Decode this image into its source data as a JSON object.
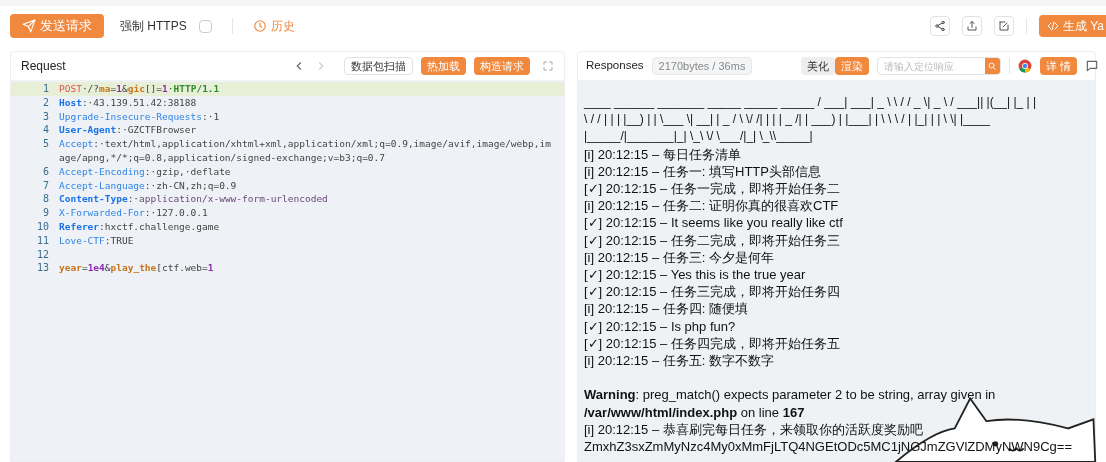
{
  "toolbar": {
    "send_button": "发送请求",
    "force_https": {
      "label": "强制 HTTPS",
      "checked": false
    },
    "history": "历史",
    "generate_button": "生成 Ya"
  },
  "request": {
    "title": "Request",
    "back_disabled": false,
    "forward_disabled": true,
    "scan_button": "数据包扫描",
    "hot_reload_button": "热加载",
    "build_button": "构造请求",
    "lines": [
      {
        "number": "1",
        "highlighted": true,
        "segments": [
          {
            "kind": "method",
            "text": "POST"
          },
          {
            "kind": "plain",
            "text": "·/?"
          },
          {
            "kind": "param",
            "text": "ma"
          },
          {
            "kind": "plain",
            "text": "="
          },
          {
            "kind": "number",
            "text": "1"
          },
          {
            "kind": "plain",
            "text": "&"
          },
          {
            "kind": "param",
            "text": "gic"
          },
          {
            "kind": "plain",
            "text": "[]="
          },
          {
            "kind": "number",
            "text": "1"
          },
          {
            "kind": "plain",
            "text": "·"
          },
          {
            "kind": "protocol",
            "text": "HTTP/1.1"
          }
        ]
      },
      {
        "number": "2",
        "highlighted": false,
        "segments": [
          {
            "kind": "key",
            "text": "Host"
          },
          {
            "kind": "plain",
            "text": ":·43.139.51.42:38188"
          }
        ]
      },
      {
        "number": "3",
        "highlighted": false,
        "segments": [
          {
            "kind": "key-light",
            "text": "Upgrade-Insecure-Requests"
          },
          {
            "kind": "plain",
            "text": ":·1"
          }
        ]
      },
      {
        "number": "4",
        "highlighted": false,
        "segments": [
          {
            "kind": "key",
            "text": "User-Agent"
          },
          {
            "kind": "plain",
            "text": ":·GZCTFBrowser"
          }
        ]
      },
      {
        "number": "5",
        "highlighted": false,
        "segments": [
          {
            "kind": "key-light",
            "text": "Accept"
          },
          {
            "kind": "plain",
            "text": ":·text/html,application/xhtml+xml,application/xml;q=0.9,image/avif,image/webp,image/apng,*/*;q=0.8,application/signed-exchange;v=b3;q=0.7"
          }
        ]
      },
      {
        "number": "6",
        "highlighted": false,
        "segments": [
          {
            "kind": "key-light",
            "text": "Accept-Encoding"
          },
          {
            "kind": "plain",
            "text": ":·gzip,·deflate"
          }
        ]
      },
      {
        "number": "7",
        "highlighted": false,
        "segments": [
          {
            "kind": "key-light",
            "text": "Accept-Language"
          },
          {
            "kind": "plain",
            "text": ":·zh-CN,zh;q=0.9"
          }
        ]
      },
      {
        "number": "8",
        "highlighted": false,
        "segments": [
          {
            "kind": "key",
            "text": "Content-Type"
          },
          {
            "kind": "plain",
            "text": ":·"
          },
          {
            "kind": "string",
            "text": "application/x-www-form-urlencoded"
          }
        ]
      },
      {
        "number": "9",
        "highlighted": false,
        "segments": [
          {
            "kind": "key-light",
            "text": "X-Forwarded-For"
          },
          {
            "kind": "plain",
            "text": ":·127.0.0.1"
          }
        ]
      },
      {
        "number": "10",
        "highlighted": false,
        "segments": [
          {
            "kind": "key",
            "text": "Referer"
          },
          {
            "kind": "plain",
            "text": ":hxctf.challenge.game"
          }
        ]
      },
      {
        "number": "11",
        "highlighted": false,
        "segments": [
          {
            "kind": "key-light",
            "text": "Love-CTF"
          },
          {
            "kind": "plain",
            "text": ":TRUE"
          }
        ]
      },
      {
        "number": "12",
        "highlighted": false
      },
      {
        "number": "13",
        "highlighted": false,
        "segments": [
          {
            "kind": "param",
            "text": "year"
          },
          {
            "kind": "plain",
            "text": "="
          },
          {
            "kind": "number",
            "text": "1e4"
          },
          {
            "kind": "plain",
            "text": "&"
          },
          {
            "kind": "param",
            "text": "play_the"
          },
          {
            "kind": "plain",
            "text": "[ctf.web="
          },
          {
            "kind": "number",
            "text": "1"
          }
        ]
      }
    ]
  },
  "response": {
    "title": "Responses",
    "stats": "2170bytes / 36ms",
    "view_modes": [
      {
        "label": "美化",
        "selected": false
      },
      {
        "label": "渲染",
        "selected": true
      }
    ],
    "search": {
      "placeholder": "请输入定位响应"
    },
    "details_button": "详 情",
    "body": [
      {
        "kind": "art",
        "text": "____ ______ _______ _____ _____ _____ / ___| ___| _ \\ \\ / / _ \\| _ \\ / ___|| |(__| |_ | |"
      },
      {
        "kind": "art",
        "text": "\\ / / | | | |__) | | \\___ \\| __| | _ / \\ \\/ /| | | | _ /| | ___) | |___| | \\ \\ \\ / | |_| | | \\ \\| |____"
      },
      {
        "kind": "art",
        "text": "|_____/|_______|_| \\_\\ \\/ \\___/|_| \\_\\\\_____|"
      },
      {
        "kind": "line",
        "text": "[i] 20:12:15 – 每日任务清单"
      },
      {
        "kind": "line",
        "text": "[i] 20:12:15 – 任务一: 填写HTTP头部信息"
      },
      {
        "kind": "line",
        "text": "[✓] 20:12:15 – 任务一完成，即将开始任务二"
      },
      {
        "kind": "line",
        "text": "[i] 20:12:15 – 任务二: 证明你真的很喜欢CTF"
      },
      {
        "kind": "line",
        "text": "[✓] 20:12:15 – It seems like you really like ctf"
      },
      {
        "kind": "line",
        "text": "[✓] 20:12:15 – 任务二完成，即将开始任务三"
      },
      {
        "kind": "line",
        "text": "[i] 20:12:15 – 任务三: 今夕是何年"
      },
      {
        "kind": "line",
        "text": "[✓] 20:12:15 – Yes this is the true year"
      },
      {
        "kind": "line",
        "text": "[✓] 20:12:15 – 任务三完成，即将开始任务四"
      },
      {
        "kind": "line",
        "text": "[i] 20:12:15 – 任务四: 随便填"
      },
      {
        "kind": "line",
        "text": "[✓] 20:12:15 – Is php fun?"
      },
      {
        "kind": "line",
        "text": "[✓] 20:12:15 – 任务四完成，即将开始任务五"
      },
      {
        "kind": "line",
        "text": "[i] 20:12:15 – 任务五: 数字不数字"
      },
      {
        "kind": "blank"
      },
      {
        "kind": "warning",
        "text": "**Warning**: preg_match() expects parameter 2 to be string, array given in **/var/www/html/index.php** on line **167**"
      },
      {
        "kind": "line",
        "text": "[i] 20:12:15 – 恭喜刷完每日任务，来领取你的活跃度奖励吧"
      },
      {
        "kind": "line",
        "text": "ZmxhZ3sxZmMyNzc4My0xMmFjLTQ4NGEtODc5MC1jNGJmZGVlZDMyNWN9Cg=="
      }
    ]
  }
}
